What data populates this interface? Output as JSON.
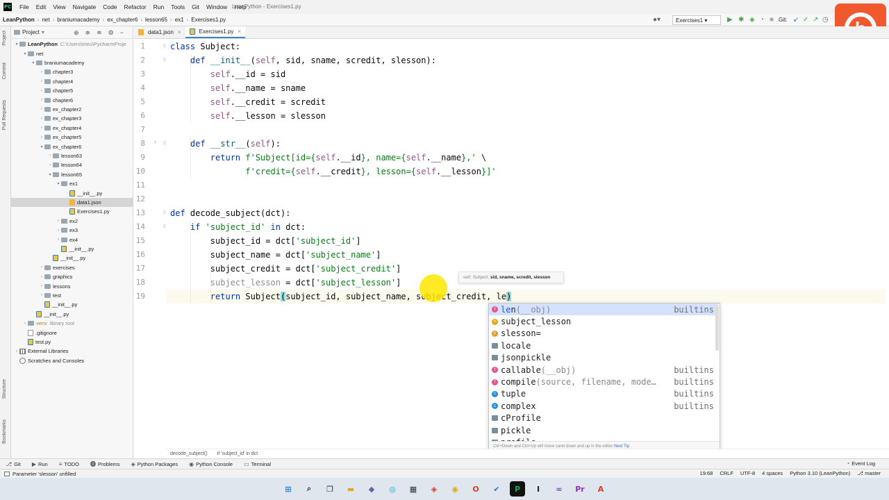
{
  "app": {
    "window_title": "LeanPython - Exercises1.py",
    "menu": [
      "File",
      "Edit",
      "View",
      "Navigate",
      "Code",
      "Refactor",
      "Run",
      "Tools",
      "Git",
      "Window",
      "Help"
    ]
  },
  "navbar": {
    "breadcrumbs": [
      "LeanPython",
      "net",
      "braniumacademy",
      "ex_chapter6",
      "lesson65",
      "ex1",
      "Exercises1.py"
    ],
    "run_config": "Exercises1",
    "git_label": "Git:"
  },
  "left_strip": {
    "labels": [
      "Project",
      "Commit",
      "Pull Requests",
      "Structure",
      "Bookmarks"
    ]
  },
  "project_panel": {
    "title": "Project",
    "tree": [
      {
        "label": "LeanPython",
        "hint": "C:\\Users\\trieu\\PycharmProje",
        "kind": "folder",
        "depth": 0,
        "arrow": "▾",
        "bold": true
      },
      {
        "label": "net",
        "kind": "folder",
        "depth": 1,
        "arrow": "▾"
      },
      {
        "label": "braniumacademy",
        "kind": "folder",
        "depth": 2,
        "arrow": "▾"
      },
      {
        "label": "chapter3",
        "kind": "folder",
        "depth": 3,
        "arrow": "›"
      },
      {
        "label": "chapter4",
        "kind": "folder",
        "depth": 3,
        "arrow": "›"
      },
      {
        "label": "chapter5",
        "kind": "folder",
        "depth": 3,
        "arrow": "›"
      },
      {
        "label": "chapter6",
        "kind": "folder",
        "depth": 3,
        "arrow": "›"
      },
      {
        "label": "ex_chapter2",
        "kind": "folder",
        "depth": 3,
        "arrow": "›"
      },
      {
        "label": "ex_chapter3",
        "kind": "folder",
        "depth": 3,
        "arrow": "›"
      },
      {
        "label": "ex_chapter4",
        "kind": "folder",
        "depth": 3,
        "arrow": "›"
      },
      {
        "label": "ex_chapter5",
        "kind": "folder",
        "depth": 3,
        "arrow": "›"
      },
      {
        "label": "ex_chapter6",
        "kind": "folder",
        "depth": 3,
        "arrow": "▾"
      },
      {
        "label": "lesson63",
        "kind": "folder",
        "depth": 4,
        "arrow": "›"
      },
      {
        "label": "lesson64",
        "kind": "folder",
        "depth": 4,
        "arrow": "›"
      },
      {
        "label": "lesson65",
        "kind": "folder",
        "depth": 4,
        "arrow": "▾"
      },
      {
        "label": "ex1",
        "kind": "folder",
        "depth": 5,
        "arrow": "▾"
      },
      {
        "label": "__init__.py",
        "kind": "py",
        "depth": 6,
        "arrow": ""
      },
      {
        "label": "data1.json",
        "kind": "json",
        "depth": 6,
        "arrow": "",
        "selected": true
      },
      {
        "label": "Exercises1.py",
        "kind": "py",
        "depth": 6,
        "arrow": ""
      },
      {
        "label": "ex2",
        "kind": "folder",
        "depth": 5,
        "arrow": "›"
      },
      {
        "label": "ex3",
        "kind": "folder",
        "depth": 5,
        "arrow": "›"
      },
      {
        "label": "ex4",
        "kind": "folder",
        "depth": 5,
        "arrow": "›"
      },
      {
        "label": "__init__.py",
        "kind": "py",
        "depth": 5,
        "arrow": ""
      },
      {
        "label": "__init__.py",
        "kind": "py",
        "depth": 4,
        "arrow": ""
      },
      {
        "label": "exercises",
        "kind": "folder",
        "depth": 3,
        "arrow": "›"
      },
      {
        "label": "graphics",
        "kind": "folder",
        "depth": 3,
        "arrow": "›"
      },
      {
        "label": "lessons",
        "kind": "folder",
        "depth": 3,
        "arrow": "›"
      },
      {
        "label": "test",
        "kind": "folder",
        "depth": 3,
        "arrow": "›"
      },
      {
        "label": "__init__.py",
        "kind": "py",
        "depth": 3,
        "arrow": ""
      },
      {
        "label": "__init__.py",
        "kind": "py",
        "depth": 2,
        "arrow": ""
      },
      {
        "label": "venv",
        "hint": "library root",
        "kind": "folder",
        "depth": 1,
        "arrow": "›",
        "venv": true
      },
      {
        "label": ".gitignore",
        "kind": "txt",
        "depth": 1,
        "arrow": ""
      },
      {
        "label": "test.py",
        "kind": "py",
        "depth": 1,
        "arrow": ""
      },
      {
        "label": "External Libraries",
        "kind": "lib",
        "depth": 0,
        "arrow": "›"
      },
      {
        "label": "Scratches and Consoles",
        "kind": "scratch",
        "depth": 0,
        "arrow": ""
      }
    ]
  },
  "tabs": [
    {
      "label": "data1.json",
      "kind": "json",
      "active": false
    },
    {
      "label": "Exercises1.py",
      "kind": "py",
      "active": true
    }
  ],
  "editor": {
    "line_numbers": [
      "1",
      "2",
      "3",
      "4",
      "5",
      "6",
      "7",
      "8",
      "9",
      "10",
      "11",
      "12",
      "13",
      "14",
      "15",
      "16",
      "17",
      "18",
      "19"
    ],
    "code": [
      [
        {
          "t": "class ",
          "c": "kw"
        },
        {
          "t": "Subject:",
          "c": ""
        }
      ],
      [
        {
          "t": "    "
        },
        {
          "t": "def ",
          "c": "kw"
        },
        {
          "t": "__init__",
          "c": "fn"
        },
        {
          "t": "("
        },
        {
          "t": "self",
          "c": "self"
        },
        {
          "t": ", sid, sname, scredit, slesson):"
        }
      ],
      [
        {
          "t": "        "
        },
        {
          "t": "self",
          "c": "self"
        },
        {
          "t": ".__id = sid"
        }
      ],
      [
        {
          "t": "        "
        },
        {
          "t": "self",
          "c": "self"
        },
        {
          "t": ".__name = sname"
        }
      ],
      [
        {
          "t": "        "
        },
        {
          "t": "self",
          "c": "self"
        },
        {
          "t": ".__credit = scredit"
        }
      ],
      [
        {
          "t": "        "
        },
        {
          "t": "self",
          "c": "self"
        },
        {
          "t": ".__lesson = slesson"
        }
      ],
      [],
      [
        {
          "t": "    "
        },
        {
          "t": "def ",
          "c": "kw"
        },
        {
          "t": "__str__",
          "c": "fn"
        },
        {
          "t": "("
        },
        {
          "t": "self",
          "c": "self"
        },
        {
          "t": "):"
        }
      ],
      [
        {
          "t": "        "
        },
        {
          "t": "return ",
          "c": "kw"
        },
        {
          "t": "f'Subject[id={",
          "c": "str"
        },
        {
          "t": "self",
          "c": "self"
        },
        {
          "t": ".__id",
          "c": ""
        },
        {
          "t": "}, name={",
          "c": "str"
        },
        {
          "t": "self",
          "c": "self"
        },
        {
          "t": ".__name",
          "c": ""
        },
        {
          "t": "},' ",
          "c": "str"
        },
        {
          "t": "\\"
        }
      ],
      [
        {
          "t": "               "
        },
        {
          "t": "f'credit={",
          "c": "str"
        },
        {
          "t": "self",
          "c": "self"
        },
        {
          "t": ".__credit",
          "c": ""
        },
        {
          "t": "}, lesson={",
          "c": "str"
        },
        {
          "t": "self",
          "c": "self"
        },
        {
          "t": ".__lesson",
          "c": ""
        },
        {
          "t": "}]'",
          "c": "str"
        }
      ],
      [],
      [],
      [
        {
          "t": "def ",
          "c": "kw"
        },
        {
          "t": "decode_subject(dct):"
        }
      ],
      [
        {
          "t": "    "
        },
        {
          "t": "if ",
          "c": "kw"
        },
        {
          "t": "'subject_id'",
          "c": "str"
        },
        {
          "t": " "
        },
        {
          "t": "in",
          "c": "kw"
        },
        {
          "t": " dct:"
        }
      ],
      [
        {
          "t": "        subject_id = dct["
        },
        {
          "t": "'subject_id'",
          "c": "str"
        },
        {
          "t": "]"
        }
      ],
      [
        {
          "t": "        subject_name = dct["
        },
        {
          "t": "'subject_name'",
          "c": "str"
        },
        {
          "t": "]"
        }
      ],
      [
        {
          "t": "        subject_credit = dct["
        },
        {
          "t": "'subject_credit'",
          "c": "str"
        },
        {
          "t": "]"
        }
      ],
      [
        {
          "t": "        "
        },
        {
          "t": "subject_lesson",
          "c": "grayed"
        },
        {
          "t": " = dct["
        },
        {
          "t": "'subject_lesson'",
          "c": "str"
        },
        {
          "t": "]"
        }
      ],
      [
        {
          "t": "        "
        },
        {
          "t": "return ",
          "c": "kw"
        },
        {
          "t": "Subject"
        },
        {
          "t": "(",
          "c": "hl-paren"
        },
        {
          "t": "subject_id, subject_name, subject_credit, le"
        },
        {
          "t": ")",
          "c": "hl-paren"
        }
      ]
    ]
  },
  "param_hint": {
    "prefix": "self: Subject, ",
    "bold": "sid, sname, scredit, slesson"
  },
  "completion": {
    "items": [
      {
        "icon": "f",
        "letter": "f",
        "match": "le",
        "rest": "n",
        "sig": "(__obj)",
        "src": "builtins",
        "selected": true
      },
      {
        "icon": "v",
        "letter": "v",
        "match": "",
        "rest": "subject_lesson",
        "sig": "",
        "src": ""
      },
      {
        "icon": "p",
        "letter": "p",
        "match": "",
        "rest": "slesson=",
        "sig": "",
        "src": ""
      },
      {
        "icon": "m",
        "letter": "",
        "match": "",
        "rest": "locale",
        "sig": "",
        "src": ""
      },
      {
        "icon": "m",
        "letter": "",
        "match": "",
        "rest": "jsonpickle",
        "sig": "",
        "src": ""
      },
      {
        "icon": "f",
        "letter": "f",
        "match": "",
        "rest": "callable",
        "sig": "(__obj)",
        "src": "builtins"
      },
      {
        "icon": "f",
        "letter": "f",
        "match": "",
        "rest": "compile",
        "sig": "(source, filename, mode…",
        "src": "builtins"
      },
      {
        "icon": "c",
        "letter": "c",
        "match": "",
        "rest": "tuple",
        "sig": "",
        "src": "builtins"
      },
      {
        "icon": "c",
        "letter": "c",
        "match": "",
        "rest": "complex",
        "sig": "",
        "src": "builtins"
      },
      {
        "icon": "m",
        "letter": "",
        "match": "",
        "rest": "cProfile",
        "sig": "",
        "src": ""
      },
      {
        "icon": "m",
        "letter": "",
        "match": "",
        "rest": "pickle",
        "sig": "",
        "src": ""
      },
      {
        "icon": "m",
        "letter": "",
        "match": "",
        "rest": "profile",
        "sig": "",
        "src": ""
      }
    ],
    "footer": "Ctrl+Down and Ctrl+Up will move caret down and up in the editor",
    "footer_tip": "Next Tip"
  },
  "breadcrumb_bottom": [
    "decode_subject()",
    "if 'subject_id' in dct"
  ],
  "tool_windows": [
    "Git",
    "Run",
    "TODO",
    "Problems",
    "Python Packages",
    "Python Console",
    "Terminal"
  ],
  "event_log": "Event Log",
  "status": {
    "message": "Parameter 'slesson' unfilled",
    "position": "19:68",
    "line_sep": "CRLF",
    "encoding": "UTF-8",
    "indent": "4 spaces",
    "interpreter": "Python 3.10 (LeanPython)",
    "branch": "master"
  },
  "brand": {
    "letter": "b",
    "color": "#f0592d"
  }
}
